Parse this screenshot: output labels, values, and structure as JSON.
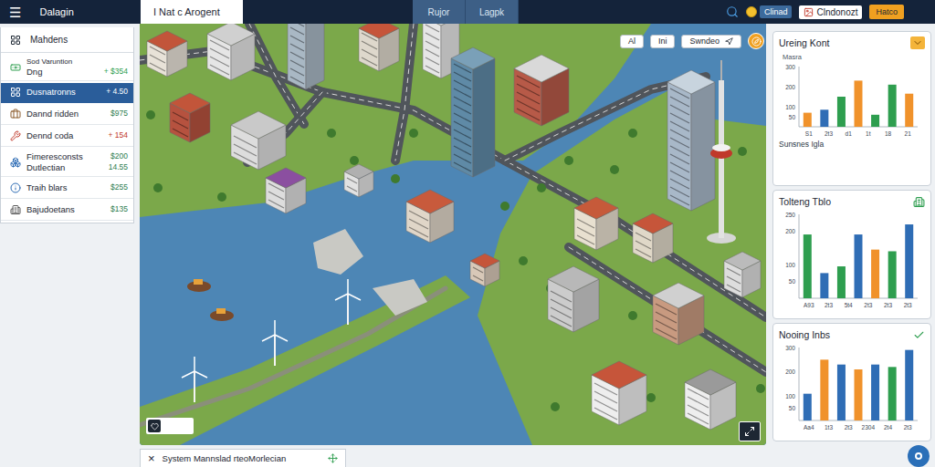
{
  "topbar": {
    "menu_icon": "☰",
    "app_name": "Dalagin",
    "document_tab": "I Nat c Arogent",
    "tabs": [
      {
        "label": "Rujor",
        "selected": false
      },
      {
        "label": "Lagpk",
        "selected": false
      }
    ],
    "coins": "Clinad",
    "user": "Clndonozt",
    "action": "Hatco"
  },
  "sidebar": {
    "title": "Mahdens",
    "items": [
      {
        "lines": [
          {
            "text": "Sod Varuntion"
          },
          {
            "text": "Dng",
            "value": "+ $354"
          }
        ],
        "value_color": "#2e9e4f",
        "selected": false
      },
      {
        "lines": [
          {
            "text": "Dusnatronns",
            "value": "+ 4.50"
          }
        ],
        "value_color": "#ffffff",
        "selected": true
      },
      {
        "lines": [
          {
            "text": "Dannd ridden",
            "value": "$975"
          }
        ],
        "value_color": "#2e7d4f",
        "selected": false
      },
      {
        "lines": [
          {
            "text": "Dennd coda",
            "value": "+ 154"
          }
        ],
        "value_color": "#c0392b",
        "selected": false
      },
      {
        "lines": [
          {
            "text": "Fimeresconsts",
            "value": "$200"
          },
          {
            "text": "Dutlectian",
            "value": "14.55"
          }
        ],
        "value_color": "#2e7d4f",
        "selected": false
      },
      {
        "lines": [
          {
            "text": "Traih blars",
            "value": "$255"
          }
        ],
        "value_color": "#2e7d4f",
        "selected": false
      },
      {
        "lines": [
          {
            "text": "Bajudoetans",
            "value": "$135"
          }
        ],
        "value_color": "#2e7d4f",
        "selected": false
      }
    ]
  },
  "map": {
    "controls": [
      {
        "label": "Al"
      },
      {
        "label": "Ini"
      },
      {
        "label": "Swndeo"
      }
    ]
  },
  "status_bar": {
    "close_icon": "×",
    "text": "System Mannslad rteoMorlecian"
  },
  "charts": [
    {
      "title": "Ureing Kont",
      "subtitle": "Masra",
      "footer": "Sunsnes Igla",
      "ticks": [
        "300",
        "200",
        "100",
        "50"
      ],
      "x_labels": [
        "S1",
        "2t3",
        "d1",
        "1t",
        "18",
        "21"
      ],
      "bars": [
        {
          "value": 70,
          "color": "#f0922b"
        },
        {
          "value": 85,
          "color": "#2f6db5"
        },
        {
          "value": 150,
          "color": "#2e9e4f"
        },
        {
          "value": 230,
          "color": "#f0922b"
        },
        {
          "value": 60,
          "color": "#2e9e4f"
        },
        {
          "value": 210,
          "color": "#2e9e4f"
        },
        {
          "value": 165,
          "color": "#f0922b"
        }
      ]
    },
    {
      "title": "Tolteng Tblo",
      "ticks": [
        "250",
        "200",
        "100",
        "50"
      ],
      "x_labels": [
        "A93",
        "2t3",
        "5t4",
        "2t3",
        "2t3",
        "2t3"
      ],
      "bars": [
        {
          "value": 190,
          "color": "#2e9e4f"
        },
        {
          "value": 75,
          "color": "#2f6db5"
        },
        {
          "value": 95,
          "color": "#2e9e4f"
        },
        {
          "value": 190,
          "color": "#2f6db5"
        },
        {
          "value": 145,
          "color": "#f0922b"
        },
        {
          "value": 140,
          "color": "#2e9e4f"
        },
        {
          "value": 220,
          "color": "#2f6db5"
        }
      ]
    },
    {
      "title": "Nooing Inbs",
      "ticks": [
        "300",
        "200",
        "100",
        "50"
      ],
      "x_labels": [
        "Aa4",
        "1t3",
        "2t3",
        "2304",
        "2t4",
        "2t3"
      ],
      "bars": [
        {
          "value": 110,
          "color": "#2f6db5"
        },
        {
          "value": 250,
          "color": "#f0922b"
        },
        {
          "value": 230,
          "color": "#2f6db5"
        },
        {
          "value": 210,
          "color": "#f0922b"
        },
        {
          "value": 230,
          "color": "#2f6db5"
        },
        {
          "value": 220,
          "color": "#2e9e4f"
        },
        {
          "value": 290,
          "color": "#2f6db5"
        }
      ]
    }
  ]
}
